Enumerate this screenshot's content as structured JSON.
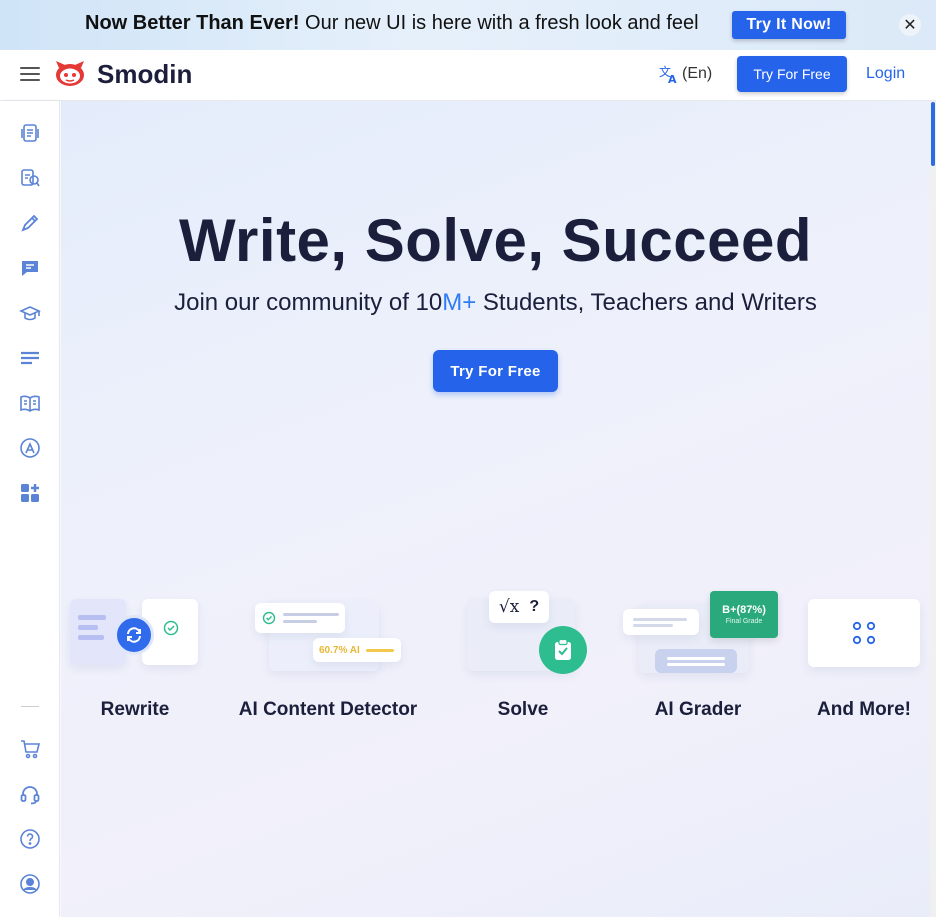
{
  "banner": {
    "headline": "Now Better Than Ever!",
    "message": " Our new UI is here with a fresh look and feel",
    "cta": "Try It Now!",
    "close": "✕"
  },
  "header": {
    "brand": "Smodin",
    "language": "(En)",
    "try_button": "Try For Free",
    "login": "Login"
  },
  "sidebar": {
    "items": [
      {
        "icon": "document-rewrite-icon"
      },
      {
        "icon": "document-search-icon"
      },
      {
        "icon": "pencil-icon"
      },
      {
        "icon": "chat-icon"
      },
      {
        "icon": "graduation-cap-icon"
      },
      {
        "icon": "text-lines-icon"
      },
      {
        "icon": "open-book-icon"
      },
      {
        "icon": "ai-writer-icon"
      },
      {
        "icon": "more-apps-icon"
      }
    ],
    "bottom_items": [
      {
        "icon": "cart-icon"
      },
      {
        "icon": "headset-icon"
      },
      {
        "icon": "help-icon"
      },
      {
        "icon": "account-icon"
      }
    ]
  },
  "hero": {
    "title": "Write, Solve, Succeed",
    "subtitle_before": "Join our community of 10",
    "subtitle_highlight": "M+",
    "subtitle_after": " Students, Teachers and Writers",
    "cta": "Try For Free"
  },
  "features": [
    {
      "label": "Rewrite"
    },
    {
      "label": "AI Content Detector",
      "badge": "60.7% AI"
    },
    {
      "label": "Solve",
      "formula": "√x",
      "question": "?"
    },
    {
      "label": "AI Grader",
      "grade": "B+(87%)",
      "grade_caption": "Final Grade"
    },
    {
      "label": "And More!"
    }
  ],
  "colors": {
    "primary": "#2563eb",
    "accent_green": "#2ebd8f",
    "icon_blue": "#5b84d6"
  }
}
